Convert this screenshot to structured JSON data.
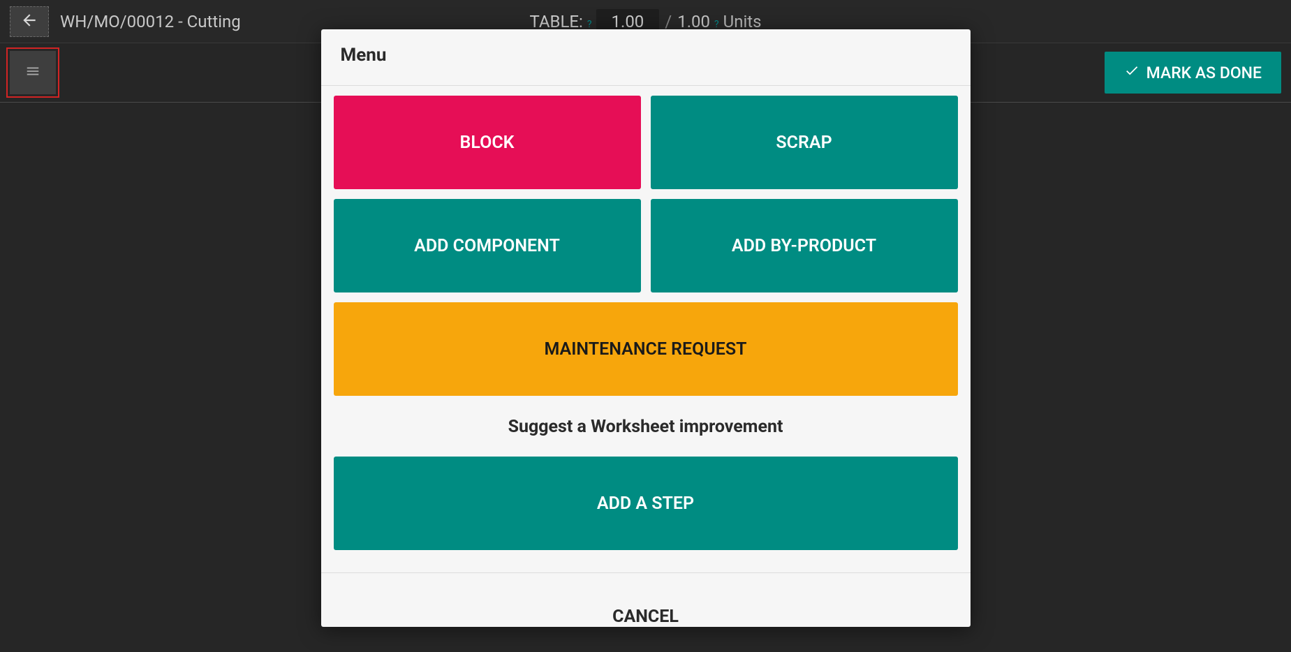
{
  "header": {
    "title": "WH/MO/00012 - Cutting",
    "table_label": "TABLE:",
    "qty_current": "1.00",
    "qty_total": "1.00",
    "units_label": "Units",
    "help_glyph": "?"
  },
  "actions": {
    "mark_done_label": "MARK AS DONE"
  },
  "modal": {
    "title": "Menu",
    "buttons": {
      "block": "BLOCK",
      "scrap": "SCRAP",
      "add_component": "ADD COMPONENT",
      "add_by_product": "ADD BY-PRODUCT",
      "maintenance_request": "MAINTENANCE REQUEST"
    },
    "suggest_subtitle": "Suggest a Worksheet improvement",
    "add_step": "ADD A STEP",
    "cancel": "CANCEL"
  }
}
